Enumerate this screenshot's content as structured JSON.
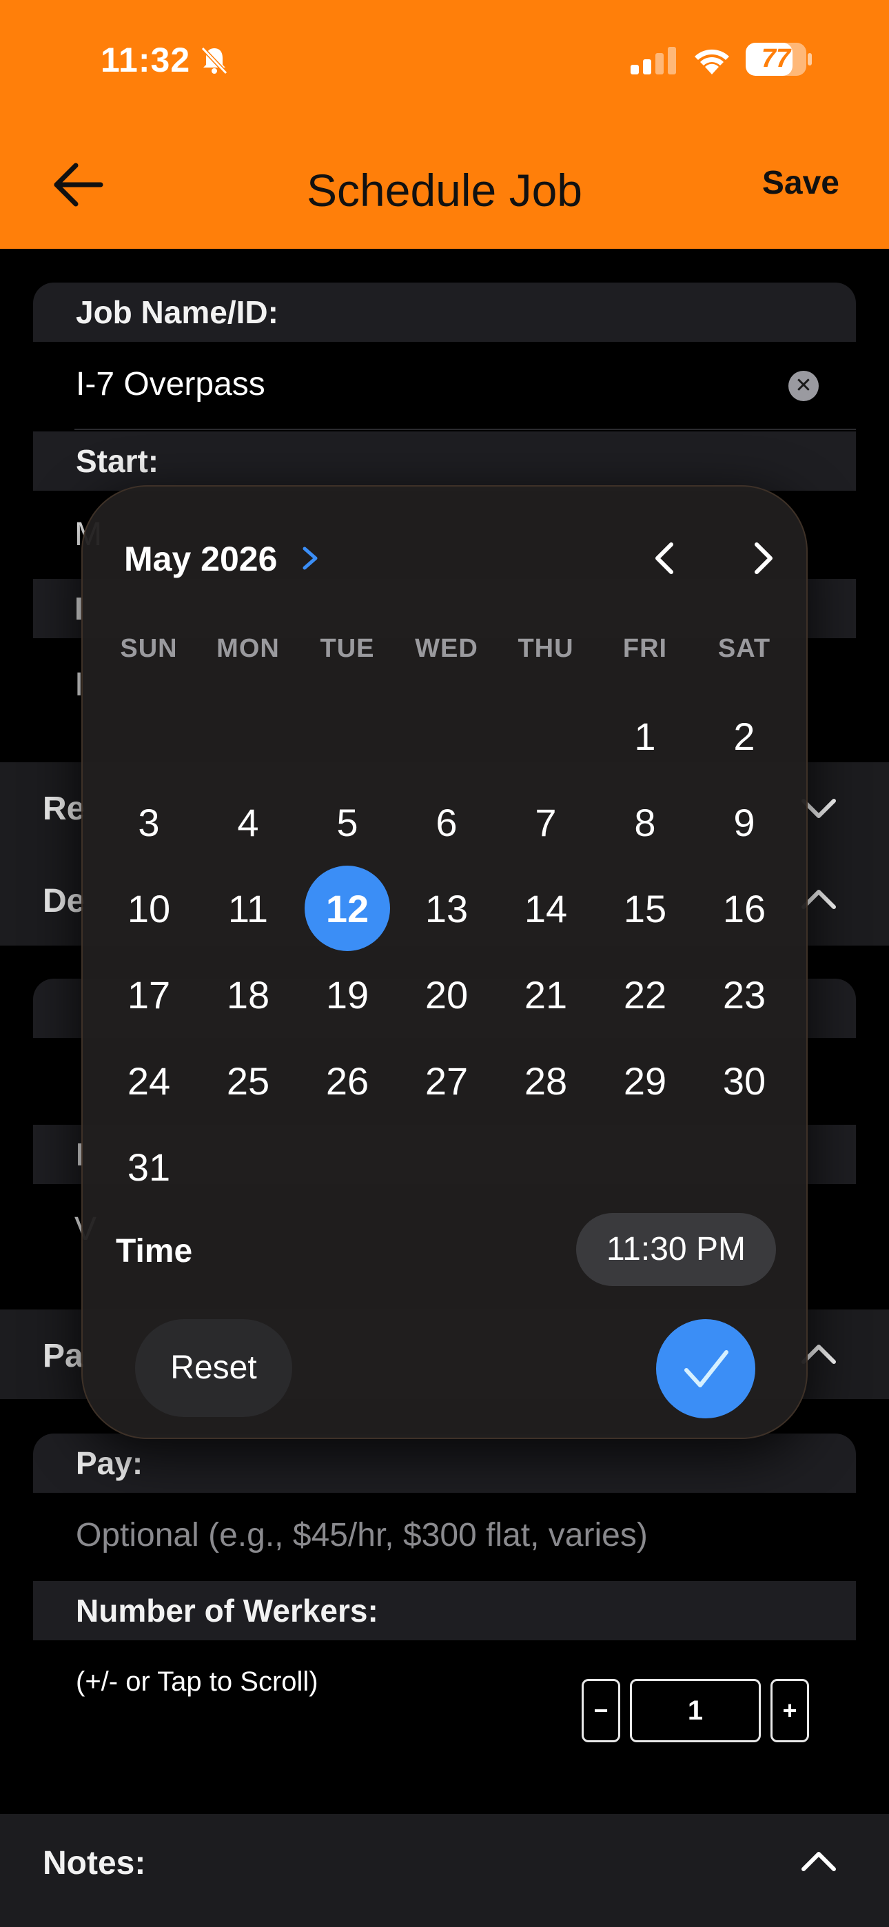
{
  "status_bar": {
    "time": "11:32",
    "battery": "77",
    "battery_level": 0.77
  },
  "nav": {
    "title": "Schedule Job",
    "save_label": "Save"
  },
  "form": {
    "job_name_label": "Job Name/ID:",
    "job_name_value": "I-7 Overpass",
    "start_label": "Start:",
    "pay_label": "Pay:",
    "pay_placeholder": "Optional (e.g., $45/hr, $300 flat, varies)",
    "workers_label": "Number of Werkers:",
    "workers_hint": "(+/- or Tap to Scroll)",
    "workers_minus": "−",
    "workers_value": "1",
    "workers_plus": "+",
    "notes_label": "Notes:"
  },
  "partial_labels": {
    "start_value_fragment": "M",
    "row3_fragment": "I",
    "row4_fragment": "I",
    "section_re": "Re",
    "section_de": "De",
    "card2_fragment": "I",
    "card2_value_fragment": "V",
    "section_pa": "Pa"
  },
  "date_picker": {
    "month_label": "May 2026",
    "weekdays": [
      "SUN",
      "MON",
      "TUE",
      "WED",
      "THU",
      "FRI",
      "SAT"
    ],
    "first_weekday_index": 5,
    "days_in_month": 31,
    "selected_day": 12,
    "time_label": "Time",
    "time_value": "11:30 PM",
    "reset_label": "Reset"
  },
  "colors": {
    "header_orange": "#FF7F0A",
    "accent_blue": "#3B8EF6",
    "background": "#000000"
  },
  "icons": {
    "back": "arrow-left-icon",
    "clear": "clear-x-icon",
    "month_expand": "chevron-right-icon",
    "prev_month": "chevron-left-icon",
    "next_month": "chevron-right-icon",
    "confirm": "checkmark-icon",
    "section_collapse": "chevron-up-icon",
    "section_expand": "chevron-down-icon"
  }
}
